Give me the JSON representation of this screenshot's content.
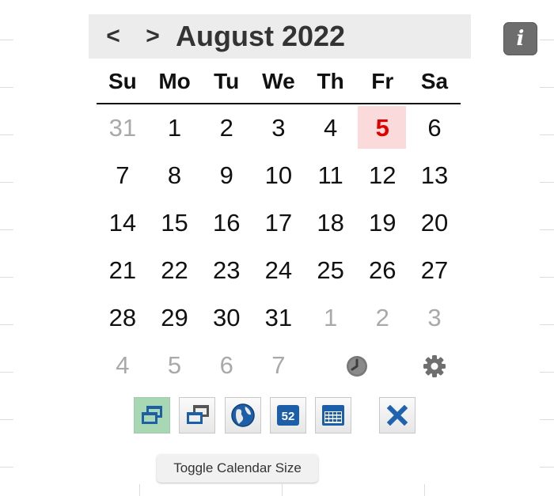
{
  "header": {
    "prev_label": "<",
    "next_label": ">",
    "month_title": "August 2022"
  },
  "info_label": "i",
  "weekdays": [
    "Su",
    "Mo",
    "Tu",
    "We",
    "Th",
    "Fr",
    "Sa"
  ],
  "weeks": [
    [
      {
        "d": "31",
        "other": true
      },
      {
        "d": "1"
      },
      {
        "d": "2"
      },
      {
        "d": "3"
      },
      {
        "d": "4"
      },
      {
        "d": "5",
        "today": true
      },
      {
        "d": "6"
      }
    ],
    [
      {
        "d": "7"
      },
      {
        "d": "8"
      },
      {
        "d": "9"
      },
      {
        "d": "10"
      },
      {
        "d": "11"
      },
      {
        "d": "12"
      },
      {
        "d": "13"
      }
    ],
    [
      {
        "d": "14"
      },
      {
        "d": "15"
      },
      {
        "d": "16"
      },
      {
        "d": "17"
      },
      {
        "d": "18"
      },
      {
        "d": "19"
      },
      {
        "d": "20"
      }
    ],
    [
      {
        "d": "21"
      },
      {
        "d": "22"
      },
      {
        "d": "23"
      },
      {
        "d": "24"
      },
      {
        "d": "25"
      },
      {
        "d": "26"
      },
      {
        "d": "27"
      }
    ],
    [
      {
        "d": "28"
      },
      {
        "d": "29"
      },
      {
        "d": "30"
      },
      {
        "d": "31"
      },
      {
        "d": "1",
        "other": true
      },
      {
        "d": "2",
        "other": true
      },
      {
        "d": "3",
        "other": true
      }
    ]
  ],
  "extra_days": [
    "4",
    "5",
    "6",
    "7"
  ],
  "icons": {
    "clock": "clock-icon",
    "settings": "gear-icon"
  },
  "toolbar": [
    {
      "name": "toggle-size-button",
      "icon": "window-restore-icon",
      "active": true
    },
    {
      "name": "window-button",
      "icon": "window-stack-icon"
    },
    {
      "name": "globe-button",
      "icon": "globe-icon"
    },
    {
      "name": "week-number-button",
      "icon": "week-number-icon",
      "text": "52"
    },
    {
      "name": "calendar-grid-button",
      "icon": "calendar-grid-icon"
    },
    {
      "name": "close-button",
      "icon": "close-icon"
    }
  ],
  "tooltip": "Toggle Calendar Size",
  "colors": {
    "today_text": "#e00000",
    "today_bg": "#fadada",
    "header_bg": "#ececec",
    "active_button_bg": "#a8d7b4",
    "icon_blue": "#1c5fa8",
    "close_blue": "#1f62b0"
  }
}
